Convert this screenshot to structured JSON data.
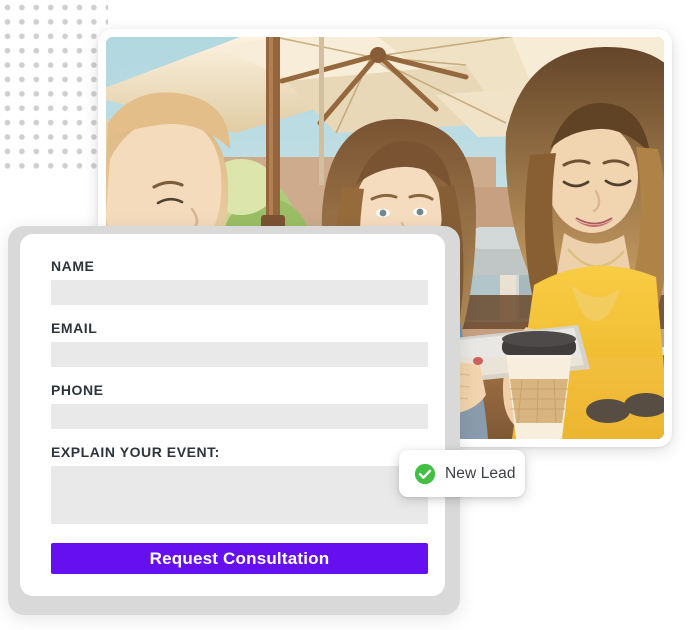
{
  "decor": {
    "dot_grid_name": "dot-grid-pattern",
    "dot_color": "#cfcfcf"
  },
  "photo_card": {
    "alt": "Three women seated at an outdoor cafe table under cream patio umbrellas, smiling and looking at a tablet with a takeaway coffee cup on the table",
    "scene": {
      "umbrella_color": "#efe3c9",
      "pole_color": "#8a5a33",
      "sky_color": "#bfe0ea",
      "building_color": "#c7a489",
      "foliage_color": "#8fbf5a",
      "table_color": "#6b4526",
      "yellow_top_color": "#f5c32c",
      "denim_color": "#6f8fb5",
      "cup_color": "#f4f3ef",
      "cup_sleeve_color": "#c9a97a",
      "lipstick_color": "#cc1f2c"
    }
  },
  "new_lead_badge": {
    "icon": "check-circle-icon",
    "icon_color": "#43c043",
    "label": "New Lead"
  },
  "form": {
    "fields": [
      {
        "label": "NAME",
        "value": "",
        "placeholder": "",
        "type": "text"
      },
      {
        "label": "EMAIL",
        "value": "",
        "placeholder": "",
        "type": "email"
      },
      {
        "label": "PHONE",
        "value": "",
        "placeholder": "",
        "type": "tel"
      },
      {
        "label": "EXPLAIN YOUR EVENT:",
        "value": "",
        "placeholder": "",
        "type": "textarea"
      }
    ],
    "submit_label": "Request Consultation",
    "submit_color": "#6610f2",
    "input_background": "#e9e9e9",
    "label_color": "#2e343b"
  }
}
